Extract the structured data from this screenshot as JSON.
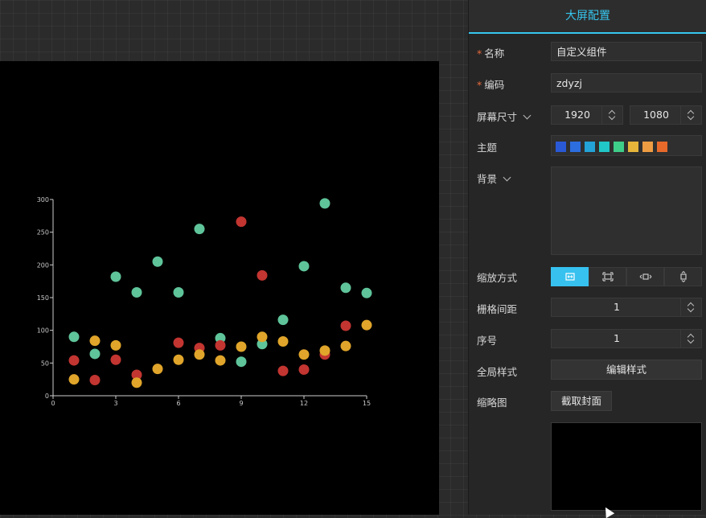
{
  "panel": {
    "title": "大屏配置",
    "name_label": "名称",
    "name_value": "自定义组件",
    "code_label": "编码",
    "code_value": "zdyzj",
    "size_label": "屏幕尺寸",
    "width_value": "1920",
    "height_value": "1080",
    "theme_label": "主题",
    "theme_colors": [
      "#2a59d6",
      "#2c6de0",
      "#23a3d8",
      "#21c7c7",
      "#3fce8a",
      "#e6b53a",
      "#ef9d43",
      "#e86a2a"
    ],
    "background_label": "背景",
    "scale_label": "缩放方式",
    "scale_options": [
      "fit-both-icon",
      "fit-screen-icon",
      "fit-width-icon",
      "fit-height-icon"
    ],
    "scale_active": 0,
    "grid_label": "栅格间距",
    "grid_value": "1",
    "order_label": "序号",
    "order_value": "1",
    "global_style_label": "全局样式",
    "edit_style_button": "编辑样式",
    "thumbnail_label": "缩略图",
    "capture_button": "截取封面",
    "accent_color": "#37c6ee"
  },
  "chart_data": {
    "type": "scatter",
    "xlim": [
      0,
      15
    ],
    "ylim": [
      0,
      300
    ],
    "xticks": [
      0,
      3,
      6,
      9,
      12,
      15
    ],
    "yticks": [
      0,
      50,
      100,
      150,
      200,
      250,
      300
    ],
    "grid": false,
    "series": [
      {
        "color": "#5fc49a",
        "points": [
          [
            1,
            90
          ],
          [
            2,
            64
          ],
          [
            3,
            182
          ],
          [
            4,
            158
          ],
          [
            5,
            205
          ],
          [
            6,
            158
          ],
          [
            7,
            255
          ],
          [
            8,
            88
          ],
          [
            9,
            52
          ],
          [
            10,
            79
          ],
          [
            11,
            116
          ],
          [
            12,
            198
          ],
          [
            13,
            294
          ],
          [
            14,
            165
          ],
          [
            15,
            157
          ]
        ]
      },
      {
        "color": "#c23531",
        "points": [
          [
            1,
            54
          ],
          [
            2,
            24
          ],
          [
            3,
            55
          ],
          [
            4,
            32
          ],
          [
            6,
            81
          ],
          [
            7,
            73
          ],
          [
            8,
            77
          ],
          [
            9,
            266
          ],
          [
            10,
            184
          ],
          [
            11,
            38
          ],
          [
            12,
            40
          ],
          [
            13,
            63
          ],
          [
            14,
            107
          ]
        ]
      },
      {
        "color": "#e0a52a",
        "points": [
          [
            1,
            25
          ],
          [
            2,
            84
          ],
          [
            3,
            77
          ],
          [
            4,
            20
          ],
          [
            5,
            41
          ],
          [
            6,
            55
          ],
          [
            7,
            63
          ],
          [
            8,
            54
          ],
          [
            9,
            75
          ],
          [
            10,
            90
          ],
          [
            11,
            83
          ],
          [
            12,
            63
          ],
          [
            13,
            69
          ],
          [
            14,
            76
          ],
          [
            15,
            108
          ]
        ]
      }
    ]
  }
}
